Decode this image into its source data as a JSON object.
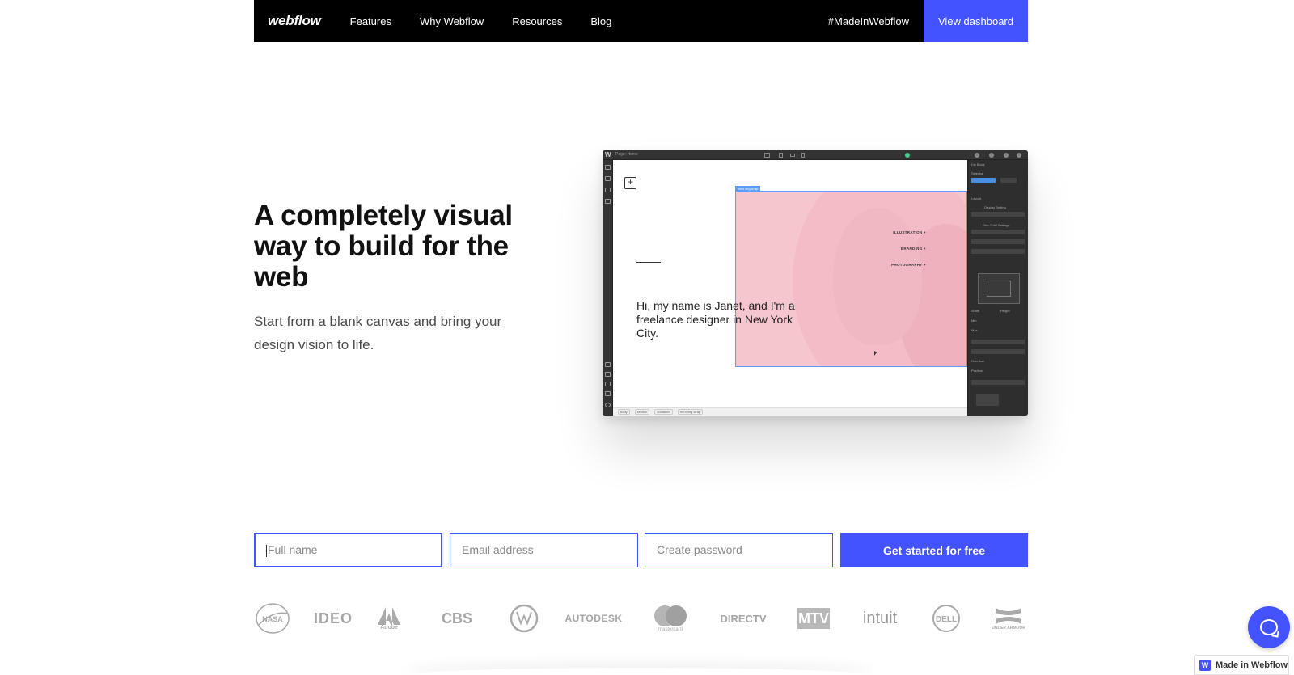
{
  "nav": {
    "logo": "webflow",
    "links": [
      "Features",
      "Why Webflow",
      "Resources",
      "Blog"
    ],
    "made_in": "#MadeInWebflow",
    "cta": "View dashboard"
  },
  "hero": {
    "title": "A completely visual way to build for the web",
    "subtitle": "Start from a blank canvas and bring your design vision to life."
  },
  "designer_mock": {
    "canvas_text": "Hi, my name is Janet, and I'm a freelance designer in New York City.",
    "menu_items": [
      "ILLUSTRATION +",
      "BRANDING +",
      "PHOTOGRAPHY +"
    ],
    "selection_tag": "hero img wrap",
    "breadcrumbs": [
      "body",
      "section",
      "container",
      "hero img wrap"
    ],
    "top_logo": "W",
    "page_label": "Page: Home",
    "panel_labels": [
      "Div Block",
      "Selector",
      "Layout",
      "Display Setting",
      "Flex Child Settings",
      "Width",
      "Height",
      "Min",
      "Max",
      "Overflow",
      "Position"
    ]
  },
  "signup": {
    "fullname_placeholder": "Full name",
    "email_placeholder": "Email address",
    "password_placeholder": "Create password",
    "submit": "Get started for free"
  },
  "logos": [
    "NASA",
    "IDEO",
    "Adobe",
    "CBS",
    "VW",
    "AUTODESK",
    "mastercard",
    "DIRECTV",
    "MTV",
    "intuit",
    "DELL",
    "UNDER ARMOUR"
  ],
  "badge": {
    "icon": "W",
    "label": "Made in Webflow"
  },
  "colors": {
    "accent": "#4353ff",
    "nav_bg": "#000000",
    "photo_pink": "#f6c6cf"
  }
}
